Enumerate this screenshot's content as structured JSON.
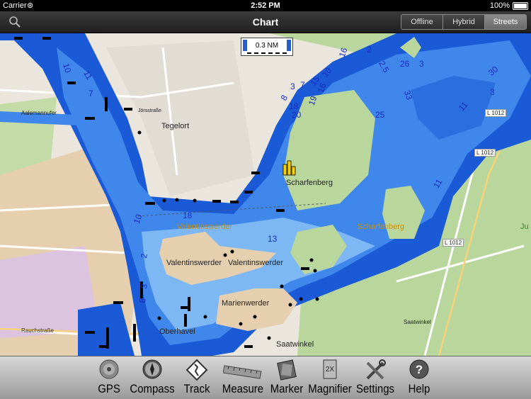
{
  "status": {
    "carrier": "Carrier",
    "time": "2:52 PM",
    "battery": "100%",
    "battery_level": 1.0
  },
  "nav": {
    "title": "Chart",
    "segments": [
      {
        "label": "Offline",
        "active": false
      },
      {
        "label": "Hybrid",
        "active": false
      },
      {
        "label": "Streets",
        "active": true
      }
    ]
  },
  "map": {
    "scale_label": "0.3 NM",
    "places": {
      "tegelort": "Tegelort",
      "scharfenberg": "Scharfenberg",
      "scharfenberg_forest": "Scharfenberg",
      "valentinswerder_1": "Valentinswerder",
      "valentinswerder_2": "Valentinswerder",
      "valentinswerder_3": "Valentinswerder",
      "marienwerder": "Marienwerder",
      "saatwinkel": "Saatwinkel",
      "saatwinkel_small": "Saatwinkel",
      "oberhavel": "Oberhavel",
      "l1012_a": "L 1012",
      "l1012_b": "L 1012",
      "l1012_c": "L 1012",
      "jo": "Ju",
      "aalemannufer": "Aalemannufer",
      "jorsstrasse": "Jörsstraße",
      "rauchstrasse": "Rauchstraße"
    },
    "depths": [
      "10",
      "11",
      "7",
      "8",
      "3",
      "7",
      "15",
      "10",
      "16",
      "19",
      "18",
      "20",
      "16",
      "2",
      "2.5",
      "26",
      "3",
      "33",
      "25",
      "30",
      "3",
      "11",
      "11",
      "18",
      "10",
      "13",
      "2",
      "8",
      "3"
    ]
  },
  "toolbar": {
    "gps": "GPS",
    "compass": "Compass",
    "track": "Track",
    "measure": "Measure",
    "marker": "Marker",
    "magnifier": "Magnifier",
    "settings": "Settings",
    "help": "Help"
  },
  "colors": {
    "water_deep": "#1a5ad6",
    "water_mid": "#3f87ea",
    "water_light": "#7db8f5",
    "land": "#eae6dd",
    "forest": "#b5d49a",
    "urban": "#e3cfb5"
  }
}
